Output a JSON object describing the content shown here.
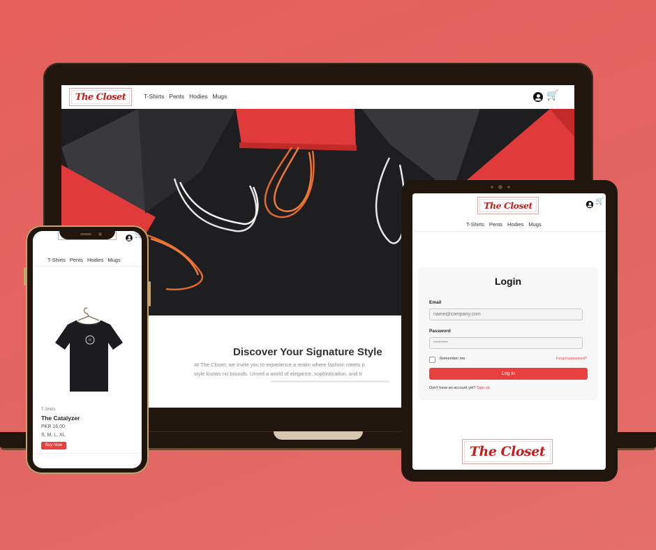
{
  "brand": {
    "name": "The Closet"
  },
  "nav": {
    "items": [
      "T-Shirts",
      "Pents",
      "Hodies",
      "Mugs"
    ]
  },
  "icons": {
    "account": "user-circle-icon",
    "cart": "cart-icon"
  },
  "colors": {
    "accent": "#e8403e",
    "background": "#e3625e",
    "device_frame": "#21160d"
  },
  "laptop": {
    "hero": {
      "title": "Discover Your Signature Style",
      "text_line1": "At The Closet, we invite you to experience a realm where fashion meets p",
      "text_line2": "style knows no bounds. Unveil a world of elegance, sophistication, and tr"
    }
  },
  "phone": {
    "product": {
      "category": "T-Shirts",
      "name": "The Catalyzer",
      "price": "PKR 16.00",
      "sizes": "S, M, L, XL",
      "buy_label": "Buy Now"
    }
  },
  "tablet": {
    "login": {
      "title": "Login",
      "email_label": "Email",
      "email_placeholder": "name@company.com",
      "password_label": "Password",
      "password_value": "••••••••",
      "remember_label": "Remember me",
      "forgot_label": "Forgot password?",
      "submit_label": "Log in",
      "signup_prompt": "Don't have an account yet?",
      "signup_label": "Sign up"
    }
  }
}
